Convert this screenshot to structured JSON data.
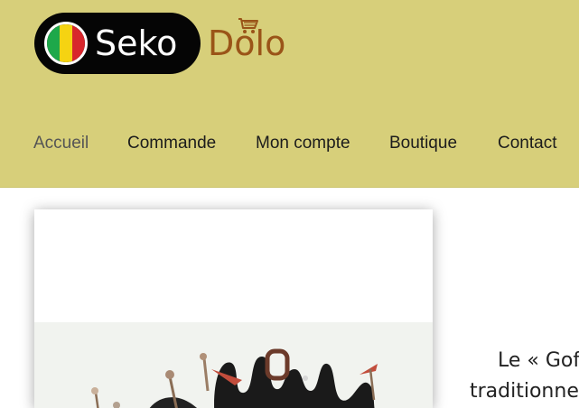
{
  "header": {
    "logo_text": "Seko",
    "brand_text": "Dolo",
    "flag_colors": [
      "#1ea84a",
      "#f5d312",
      "#d8262c"
    ],
    "cart_icon": "shopping-cart-icon",
    "brand_color": "#9a5418",
    "background": "#d7cf7a"
  },
  "nav": {
    "items": [
      {
        "label": "Accueil",
        "active": true
      },
      {
        "label": "Commande"
      },
      {
        "label": "Mon compte"
      },
      {
        "label": "Boutique"
      },
      {
        "label": "Contact"
      }
    ]
  },
  "content": {
    "image_alt": "traditional Gofo object",
    "side_text": {
      "line1": "Le « Gof",
      "line2": "traditionnel"
    }
  }
}
